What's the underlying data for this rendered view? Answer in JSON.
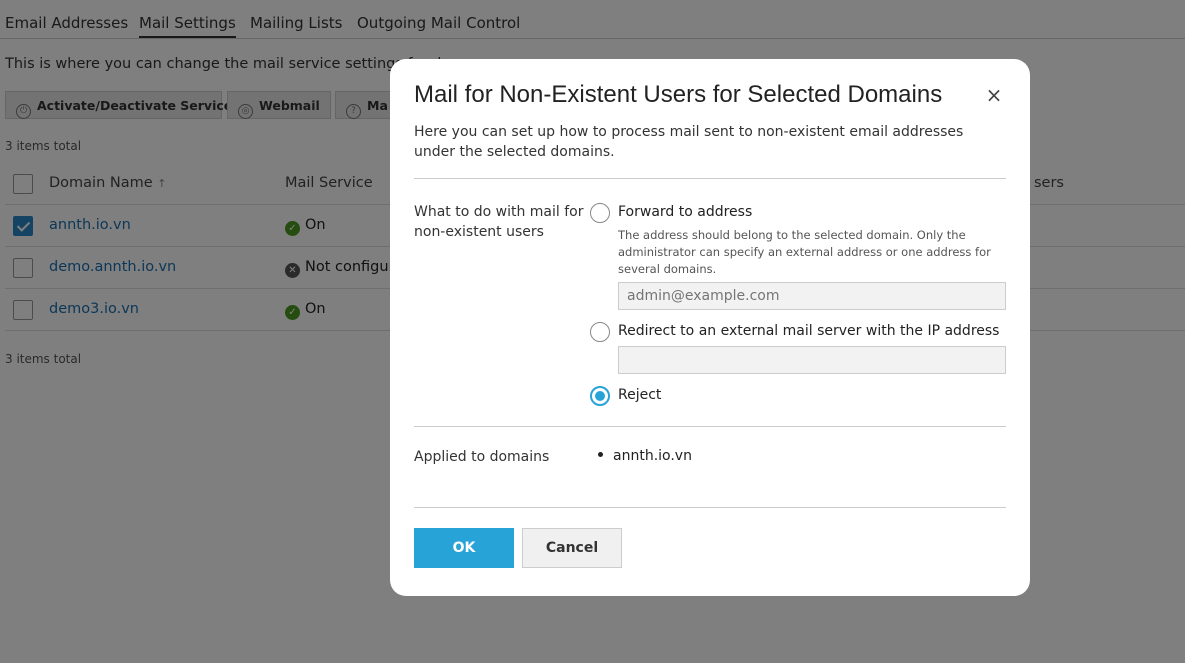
{
  "tabs": [
    "Email Addresses",
    "Mail Settings",
    "Mailing Lists",
    "Outgoing Mail Control"
  ],
  "intro": "This is where you can change the mail service settings for d",
  "toolbar": {
    "activate": "Activate/Deactivate Services",
    "webmail": "Webmail",
    "mail": "Ma"
  },
  "items_total": "3 items total",
  "grid": {
    "col_domain": "Domain Name",
    "sort_arrow": "↑",
    "col_mail_service": "Mail Service",
    "col_users": "sers",
    "rows": [
      {
        "domain": "annth.io.vn",
        "status": "On",
        "checked": true
      },
      {
        "domain": "demo.annth.io.vn",
        "status": "Not configure",
        "checked": false
      },
      {
        "domain": "demo3.io.vn",
        "status": "On",
        "checked": false
      }
    ]
  },
  "dialog": {
    "title": "Mail for Non-Existent Users for Selected Domains",
    "close_glyph": "×",
    "description": "Here you can set up how to process mail sent to non-existent email addresses under the selected domains.",
    "question": "What to do with mail for non-existent users",
    "forward_label": "Forward to address",
    "forward_hint": "The address should belong to the selected domain. Only the administrator can specify an external address or one address for several domains.",
    "forward_placeholder": "admin@example.com",
    "redirect_label": "Redirect to an external mail server with the IP address",
    "redirect_value": "",
    "reject_label": "Reject",
    "selected_option": "reject",
    "applied_label": "Applied to domains",
    "applied_domains": [
      "annth.io.vn"
    ],
    "ok_label": "OK",
    "cancel_label": "Cancel"
  },
  "colors": {
    "primary": "#28a3d8",
    "link": "#1a6fb0",
    "status_ok": "#4a9a1e"
  }
}
